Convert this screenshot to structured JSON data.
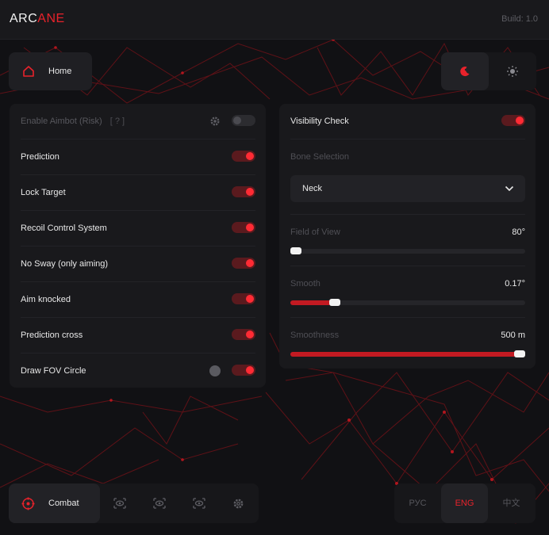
{
  "app": {
    "logo_part1": "ARC",
    "logo_part2": "ANE",
    "build": "Build: 1.0"
  },
  "header": {
    "home_label": "Home",
    "home_icon": "home-icon",
    "theme_dark_icon": "moon-icon",
    "theme_light_icon": "sun-icon"
  },
  "aimbot": {
    "enable": {
      "label": "Enable Aimbot (Risk)",
      "hint": "[ ? ]",
      "on": false
    },
    "prediction": {
      "label": "Prediction",
      "on": true
    },
    "lock_target": {
      "label": "Lock Target",
      "on": true
    },
    "recoil": {
      "label": "Recoil Control System",
      "on": true
    },
    "no_sway": {
      "label": "No Sway (only aiming)",
      "on": true
    },
    "aim_knocked": {
      "label": "Aim knocked",
      "on": true
    },
    "prediction_cross": {
      "label": "Prediction cross",
      "on": true
    },
    "draw_fov": {
      "label": "Draw FOV Circle",
      "on": true
    }
  },
  "settings": {
    "visibility_check": {
      "label": "Visibility Check",
      "on": true
    },
    "bone_selection": {
      "label": "Bone Selection",
      "selected": "Neck"
    },
    "fov": {
      "label": "Field of View",
      "value": "80°",
      "fraction": 0.0
    },
    "smooth": {
      "label": "Smooth",
      "value": "0.17°",
      "fraction": 0.19
    },
    "smoothness": {
      "label": "Smoothness",
      "value": "500 m",
      "fraction": 1.0
    }
  },
  "nav": {
    "combat_label": "Combat",
    "tabs": [
      "crosshair-icon",
      "eye-icon",
      "eye-icon",
      "eye-icon",
      "gear-icon"
    ]
  },
  "languages": {
    "ru": "РУС",
    "en": "ENG",
    "zh": "中文",
    "active": "en"
  },
  "colors": {
    "accent": "#e8222b",
    "panel": "#19191c",
    "background": "#111114"
  }
}
